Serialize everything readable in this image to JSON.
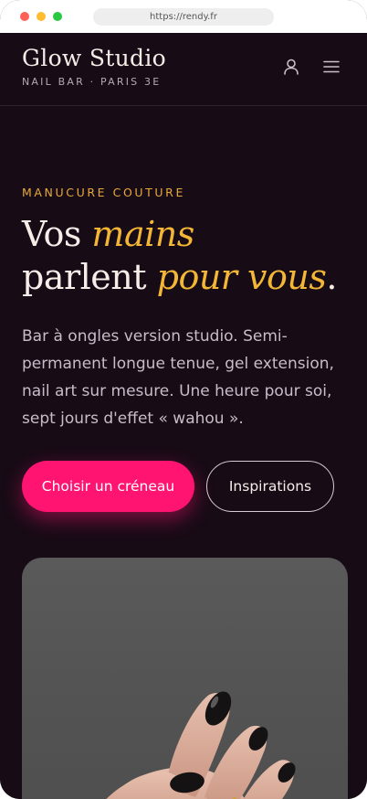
{
  "browser": {
    "url": "https://rendy.fr"
  },
  "nav": {
    "logo_title": "Glow Studio",
    "logo_subtitle": "NAIL BAR · PARIS 3E",
    "account_icon": "user-icon",
    "menu_icon": "hamburger-menu-icon"
  },
  "hero": {
    "eyebrow": "MANUCURE COUTURE",
    "headline": {
      "part1": "Vos ",
      "accent1": "mains",
      "part2": "parlent ",
      "accent2": "pour vous",
      "end": "."
    },
    "lede": "Bar à ongles version studio. Semi-permanent longue tenue, gel extension, nail art sur mesure. Une heure pour soi, sept jours d'effet « wahou ».",
    "primary_cta": "Choisir un créneau",
    "secondary_cta": "Inspirations"
  },
  "colors": {
    "background": "#170b16",
    "accent_gold": "#f3b735",
    "accent_pink": "#ff1472",
    "text_light": "#f5ede7"
  }
}
